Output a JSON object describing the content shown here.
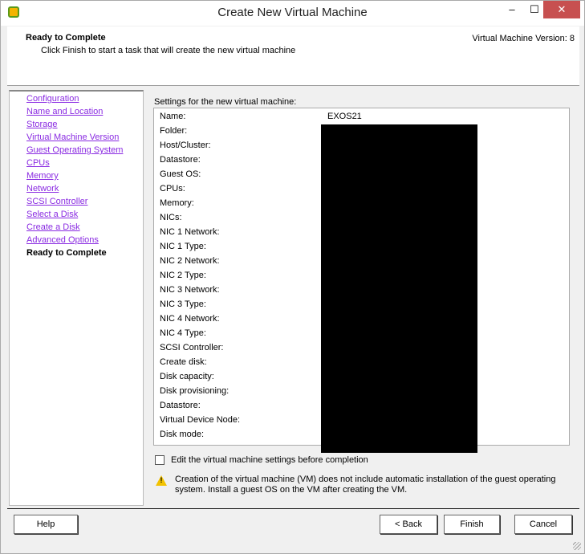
{
  "window": {
    "title": "Create New Virtual Machine",
    "minimize": "–",
    "maximize": "☐",
    "close": "✕"
  },
  "header": {
    "title": "Ready to Complete",
    "subtitle": "Click Finish to start a task that will create the new virtual machine",
    "version": "Virtual Machine Version: 8"
  },
  "nav": [
    "Configuration",
    "Name and Location",
    "Storage",
    "Virtual Machine Version",
    "Guest Operating System",
    "CPUs",
    "Memory",
    "Network",
    "SCSI Controller",
    "Select a Disk",
    "Create a Disk",
    "Advanced Options",
    "Ready to Complete"
  ],
  "settings": {
    "label": "Settings for the new virtual machine:",
    "rows": [
      "Name:",
      "Folder:",
      "Host/Cluster:",
      "Datastore:",
      "Guest OS:",
      "CPUs:",
      "Memory:",
      "NICs:",
      "NIC 1 Network:",
      "NIC 1 Type:",
      "NIC 2 Network:",
      "NIC 2 Type:",
      "NIC 3 Network:",
      "NIC 3 Type:",
      "NIC 4 Network:",
      "NIC 4 Type:",
      "SCSI Controller:",
      "Create disk:",
      "Disk capacity:",
      "Disk provisioning:",
      "Datastore:",
      "Virtual Device Node:",
      "Disk mode:"
    ],
    "name_value": "EXOS21"
  },
  "edit_checkbox": {
    "label": "Edit the virtual machine settings before completion",
    "checked": false
  },
  "warning": "Creation of the virtual machine (VM) does not include automatic installation of the guest operating system. Install a guest OS on the VM after creating the VM.",
  "buttons": {
    "help": "Help",
    "back": "< Back",
    "finish": "Finish",
    "cancel": "Cancel"
  }
}
